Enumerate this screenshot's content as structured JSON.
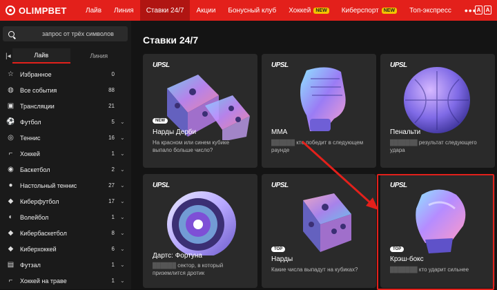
{
  "brand": {
    "name": "OLIMPBET"
  },
  "nav": {
    "items": [
      {
        "label": "Лайв"
      },
      {
        "label": "Линия"
      },
      {
        "label": "Ставки 24/7",
        "active": true
      },
      {
        "label": "Акции"
      },
      {
        "label": "Бонусный клуб"
      },
      {
        "label": "Хоккей",
        "badge": "NEW"
      },
      {
        "label": "Киберспорт",
        "badge": "NEW"
      },
      {
        "label": "Топ-экспресс"
      }
    ],
    "more": "•••",
    "lang": [
      "A",
      "A"
    ]
  },
  "sidebar": {
    "search_placeholder": "запрос от трёх символов",
    "tabs": [
      "Лайв",
      "Линия"
    ],
    "items": [
      {
        "label": "Избранное",
        "count": "0",
        "icon": "star-icon"
      },
      {
        "label": "Все события",
        "count": "88",
        "icon": "globe-icon"
      },
      {
        "label": "Трансляции",
        "count": "21",
        "icon": "video-icon"
      },
      {
        "label": "Футбол",
        "count": "5",
        "icon": "football-icon",
        "expand": true
      },
      {
        "label": "Теннис",
        "count": "16",
        "icon": "tennis-icon",
        "expand": true
      },
      {
        "label": "Хоккей",
        "count": "1",
        "icon": "hockey-icon",
        "expand": true
      },
      {
        "label": "Баскетбол",
        "count": "2",
        "icon": "basketball-icon",
        "expand": true
      },
      {
        "label": "Настольный теннис",
        "count": "27",
        "icon": "table-tennis-icon",
        "expand": true
      },
      {
        "label": "Киберфутбол",
        "count": "17",
        "icon": "gamepad-icon",
        "expand": true
      },
      {
        "label": "Волейбол",
        "count": "1",
        "icon": "volleyball-icon",
        "expand": true
      },
      {
        "label": "Кибербаскетбол",
        "count": "8",
        "icon": "gamepad-icon",
        "expand": true
      },
      {
        "label": "Киберхоккей",
        "count": "6",
        "icon": "gamepad-icon",
        "expand": true
      },
      {
        "label": "Футзал",
        "count": "1",
        "icon": "futsal-icon",
        "expand": true
      },
      {
        "label": "Хоккей на траве",
        "count": "1",
        "icon": "field-hockey-icon",
        "expand": true
      }
    ]
  },
  "main": {
    "title": "Ставки 24/7",
    "cards": [
      {
        "logo": "UPSL",
        "tag": "NEW",
        "title": "Нарды Дерби",
        "desc1": "На красном или синем кубике",
        "desc2": "выпало больше число?"
      },
      {
        "logo": "UPSL",
        "tag": "",
        "title": "MMA",
        "desc1": "кто победит в следующем",
        "desc2": "раунде"
      },
      {
        "logo": "UPSL",
        "tag": "",
        "title": "Пенальти",
        "desc1": "результат следующего",
        "desc2": "удара"
      },
      {
        "logo": "UPSL",
        "tag": "",
        "title": "Дартс: Фортуна",
        "desc1": "сектор, в который",
        "desc2": "приземлится дротик"
      },
      {
        "logo": "UPSL",
        "tag": "TOP",
        "title": "Нарды",
        "desc1": "Какие числа выпадут на кубиках?",
        "desc2": ""
      },
      {
        "logo": "UPSL",
        "tag": "TOP",
        "title": "Крэш-бокс",
        "desc1": "кто ударит сильнее",
        "desc2": ""
      }
    ]
  },
  "colors": {
    "brand_red": "#e3201b",
    "background": "#141414",
    "card": "#2a2a2a"
  }
}
